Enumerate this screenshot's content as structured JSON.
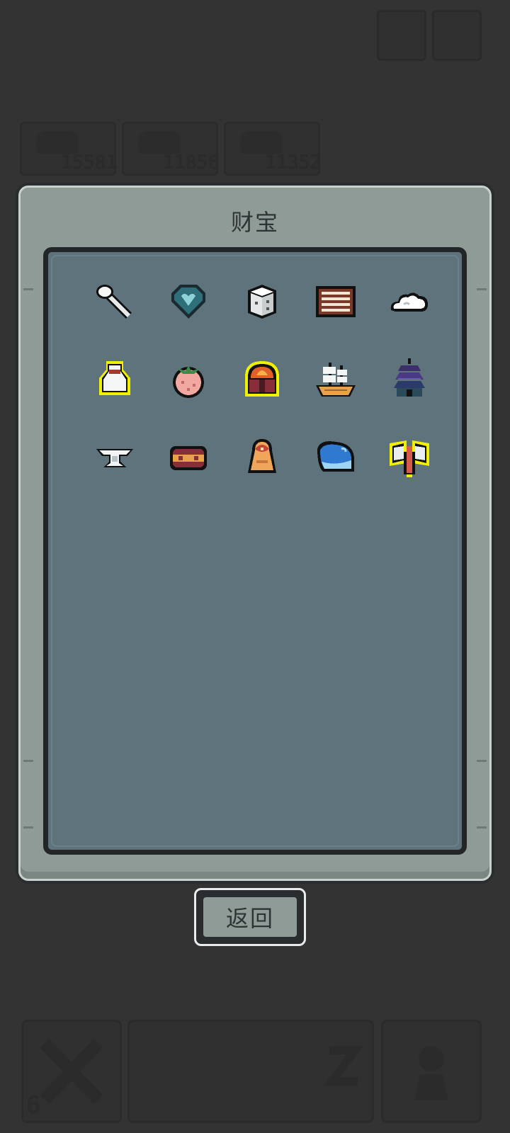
{
  "dialog": {
    "title": "财宝"
  },
  "back_button": {
    "label": "返回"
  },
  "background": {
    "scores": [
      "15581",
      "11856",
      "11352"
    ],
    "inventory_count": "6"
  },
  "treasures": [
    {
      "icon": "spoon-icon",
      "highlighted": false
    },
    {
      "icon": "heart-gem-icon",
      "highlighted": false
    },
    {
      "icon": "dice-icon",
      "highlighted": false
    },
    {
      "icon": "abacus-icon",
      "highlighted": false
    },
    {
      "icon": "cloud-icon",
      "highlighted": false
    },
    {
      "icon": "vase-icon",
      "highlighted": true
    },
    {
      "icon": "peach-icon",
      "highlighted": false
    },
    {
      "icon": "fire-chest-icon",
      "highlighted": true
    },
    {
      "icon": "ship-icon",
      "highlighted": false
    },
    {
      "icon": "pagoda-icon",
      "highlighted": false
    },
    {
      "icon": "anvil-icon",
      "highlighted": false
    },
    {
      "icon": "burger-icon",
      "highlighted": false
    },
    {
      "icon": "bell-robe-icon",
      "highlighted": false
    },
    {
      "icon": "whale-icon",
      "highlighted": false
    },
    {
      "icon": "battle-axe-icon",
      "highlighted": true
    }
  ]
}
